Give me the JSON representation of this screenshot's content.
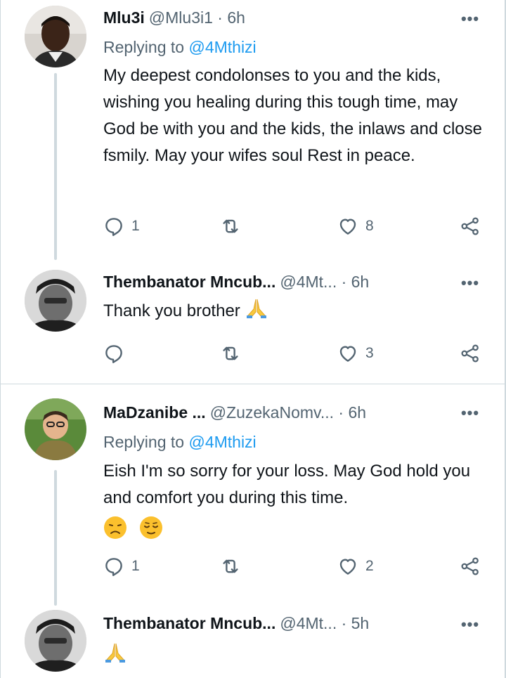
{
  "tweets": [
    {
      "name": "Mlu3i",
      "handle": "@Mlu3i1 · 6h",
      "replying_prefix": "Replying to",
      "replying_to": "@4Mthizi",
      "text": "My deepest condolonses to you and the kids, wishing you healing during this tough time, may God be with you and the kids, the inlaws and close fsmily. May your wifes soul Rest in peace.",
      "replies": "1",
      "retweets": "",
      "likes": "8",
      "more": "•••"
    },
    {
      "name": "Thembanator Mncub...",
      "handle": "@4Mt... · 6h",
      "text": "Thank you brother",
      "emoji": "folded-hands",
      "replies": "",
      "retweets": "",
      "likes": "3",
      "more": "•••"
    },
    {
      "name": "MaDzanibe ...",
      "handle": "@ZuzekaNomv... · 6h",
      "replying_prefix": "Replying to",
      "replying_to": "@4Mthizi",
      "text": "Eish I'm so sorry for your loss. May God hold you and comfort you during this time.",
      "emoji": [
        "disappointed-face",
        "relieved-face"
      ],
      "replies": "1",
      "retweets": "",
      "likes": "2",
      "more": "•••"
    },
    {
      "name": "Thembanator Mncub...",
      "handle": "@4Mt... · 5h",
      "emoji": "folded-hands",
      "more": "•••"
    }
  ],
  "colors": {
    "text": "#0f1419",
    "secondary": "#536471",
    "link": "#1d9bf0",
    "border": "#cfd9de"
  }
}
